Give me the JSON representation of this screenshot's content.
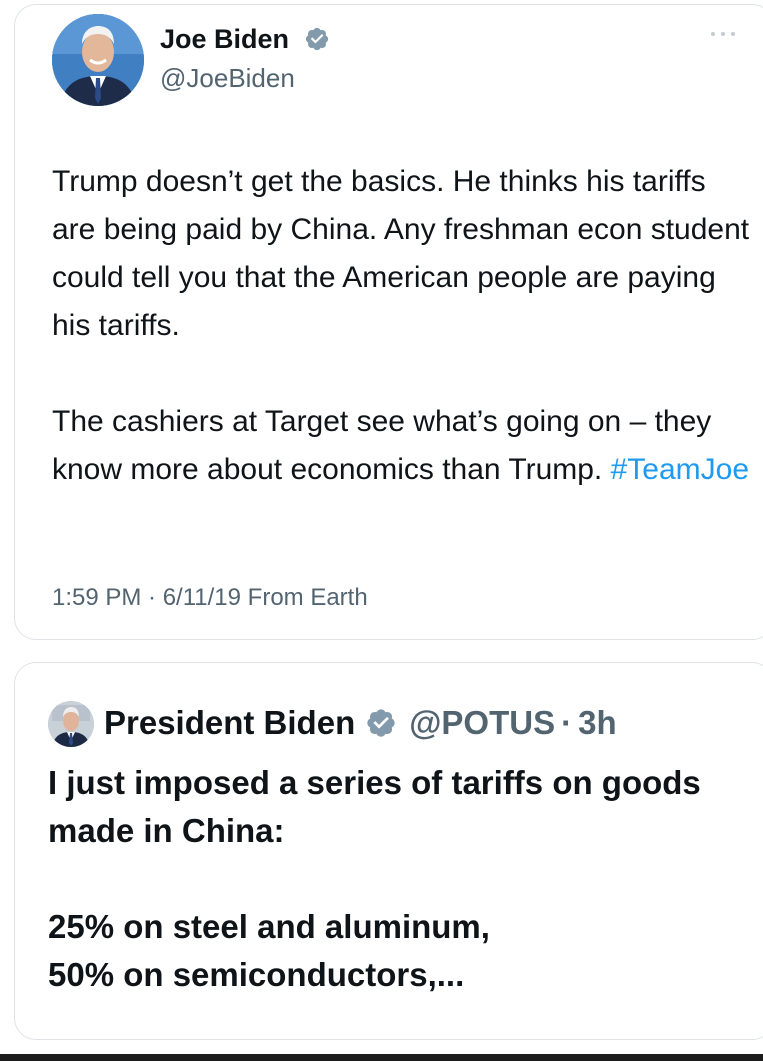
{
  "tweet": {
    "author_name": "Joe Biden",
    "author_handle": "@JoeBiden",
    "verified_icon": "verified-badge-icon",
    "more_icon": "more-options-icon",
    "text_paragraph_1": "Trump doesn’t get the basics. He thinks his tariffs are being paid by China. Any freshman econ student could tell you that the American people are paying his tariffs.",
    "text_paragraph_2_prefix": "The cashiers at Target see what’s going on – they know more about economics than Trump.",
    "hashtag": "#TeamJoe",
    "timestamp": "1:59 PM · 6/11/19 From Earth",
    "colors": {
      "name": "#0f1419",
      "secondary": "#536471",
      "link": "#1d9bf0",
      "verified_badge": "#829aab",
      "border": "#dfe3e7"
    }
  },
  "quoted_tweet": {
    "author_name": "President Biden",
    "author_handle": "@POTUS",
    "separator": "·",
    "time_ago": "3h",
    "verified_icon": "verified-badge-icon",
    "text_paragraph_1": "I just imposed a series of tariffs on goods made in China:",
    "text_line_2": "25% on steel and aluminum,",
    "text_line_3": "50% on semiconductors,..."
  }
}
